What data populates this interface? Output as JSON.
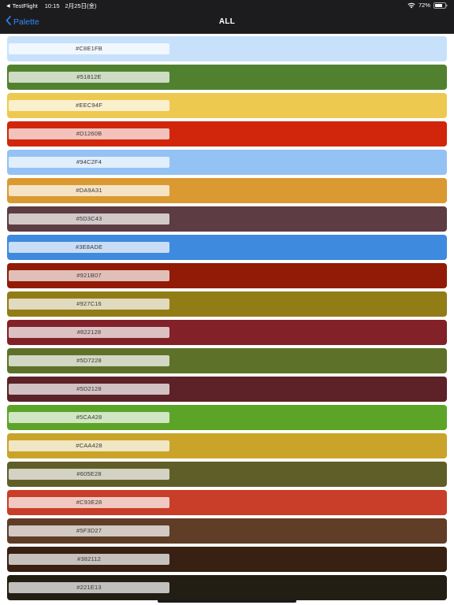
{
  "status_bar": {
    "back_app": "TestFlight",
    "time": "10:15",
    "date": "2月25日(金)",
    "battery": "72%"
  },
  "nav": {
    "back_label": "Palette",
    "title": "ALL"
  },
  "swatches": [
    {
      "hex": "#C8E1FB",
      "color": "#C8E1FB"
    },
    {
      "hex": "#51812E",
      "color": "#51812E"
    },
    {
      "hex": "#EEC94F",
      "color": "#EEC94F"
    },
    {
      "hex": "#D1260B",
      "color": "#D1260B"
    },
    {
      "hex": "#94C2F4",
      "color": "#94C2F4"
    },
    {
      "hex": "#DA9A31",
      "color": "#DA9A31"
    },
    {
      "hex": "#5D3C43",
      "color": "#5D3C43"
    },
    {
      "hex": "#3E8ADE",
      "color": "#3E8ADE"
    },
    {
      "hex": "#921B07",
      "color": "#921B07"
    },
    {
      "hex": "#927C16",
      "color": "#927C16"
    },
    {
      "hex": "#822128",
      "color": "#822128"
    },
    {
      "hex": "#5D7228",
      "color": "#5D7228"
    },
    {
      "hex": "#5D2128",
      "color": "#5D2128"
    },
    {
      "hex": "#5CA428",
      "color": "#5CA428"
    },
    {
      "hex": "#CAA428",
      "color": "#CAA428"
    },
    {
      "hex": "#605E28",
      "color": "#605E28"
    },
    {
      "hex": "#C93E28",
      "color": "#C93E28"
    },
    {
      "hex": "#5F3D27",
      "color": "#5F3D27"
    },
    {
      "hex": "#382112",
      "color": "#382112"
    },
    {
      "hex": "#221E13",
      "color": "#221E13"
    }
  ]
}
